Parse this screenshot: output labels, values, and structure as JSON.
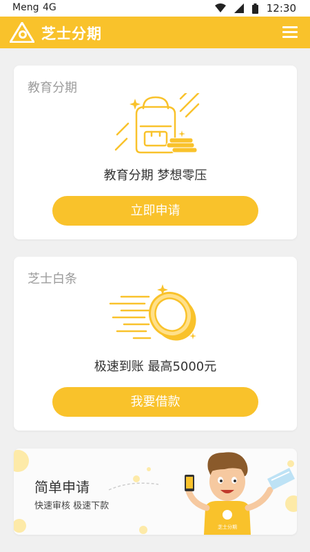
{
  "status_bar": {
    "carrier": "Meng",
    "network": "4G",
    "time": "12:30"
  },
  "app_bar": {
    "title": "芝士分期",
    "logo_icon": "zhishi-logo-icon",
    "menu_icon": "hamburger-menu-icon"
  },
  "cards": [
    {
      "title": "教育分期",
      "illustration": "backpack-icon",
      "slogan": "教育分期 梦想零压",
      "button": "立即申请"
    },
    {
      "title": "芝士白条",
      "illustration": "coin-icon",
      "slogan": "极速到账 最高5000元",
      "button": "我要借款"
    }
  ],
  "promo": {
    "title": "简单申请",
    "subtitle": "快速审核 极速下款",
    "illustration": "mascot-icon",
    "shirt_text": "芝士分期"
  },
  "colors": {
    "accent": "#f9c22b",
    "background": "#f0f0f0",
    "card": "#ffffff"
  }
}
